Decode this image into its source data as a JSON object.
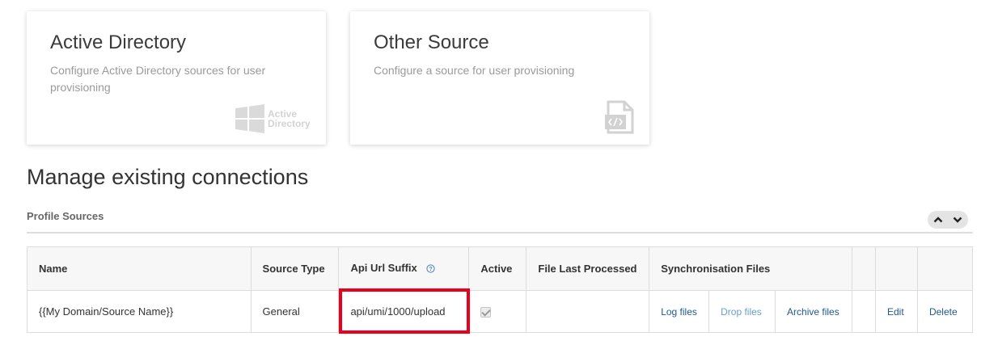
{
  "cards": {
    "active_directory": {
      "title": "Active Directory",
      "description": "Configure Active Directory sources for user provisioning",
      "logo_text_1": "Active",
      "logo_text_2": "Directory",
      "icon": "windows-logo-icon"
    },
    "other_source": {
      "title": "Other Source",
      "description": "Configure a source for user provisioning",
      "icon": "code-file-icon"
    }
  },
  "section": {
    "title": "Manage existing connections",
    "panel_label": "Profile Sources"
  },
  "table": {
    "headers": {
      "name": "Name",
      "source_type": "Source Type",
      "api_url_suffix": "Api Url Suffix",
      "active": "Active",
      "file_last_processed": "File Last Processed",
      "synchronisation_files": "Synchronisation Files"
    },
    "rows": [
      {
        "name": "{{My Domain/Source Name}}",
        "source_type": "General",
        "api_url_suffix": "api/umi/1000/upload",
        "active": true,
        "file_last_processed": "",
        "log_files": "Log files",
        "drop_files": "Drop files",
        "archive_files": "Archive files",
        "edit": "Edit",
        "delete": "Delete"
      }
    ]
  },
  "colors": {
    "highlight": "#e8001c",
    "link": "#1f5a8a",
    "muted_text": "#9a9a9a"
  }
}
